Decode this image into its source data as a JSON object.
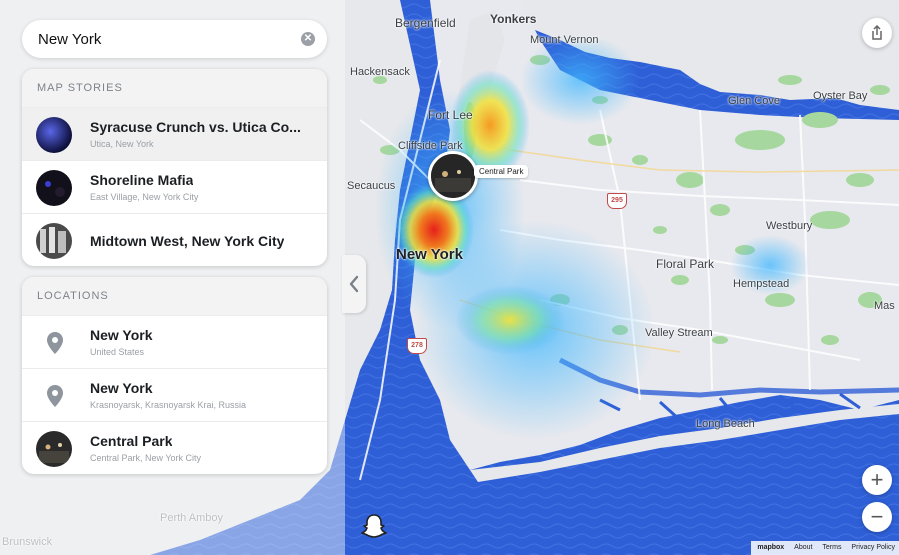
{
  "search": {
    "value": "New York",
    "clear_icon": "clear-icon"
  },
  "map_stories": {
    "header": "MAP STORIES",
    "items": [
      {
        "title": "Syracuse Crunch vs. Utica Co...",
        "subtitle": "Utica, New York",
        "thumb_color": "#1a1f6e"
      },
      {
        "title": "Shoreline Mafia",
        "subtitle": "East Village, New York City",
        "thumb_color": "#15131c"
      },
      {
        "title": "Midtown West, New York City",
        "subtitle": "",
        "thumb_color": "#3b3b3b"
      }
    ]
  },
  "locations": {
    "header": "LOCATIONS",
    "items": [
      {
        "title": "New York",
        "subtitle": "United States",
        "icon": "location-pin-icon"
      },
      {
        "title": "New York",
        "subtitle": "Krasnoyarsk, Krasnoyarsk Krai, Russia",
        "icon": "location-pin-icon"
      },
      {
        "title": "Central Park",
        "subtitle": "Central Park, New York City",
        "icon": "place-photo"
      }
    ]
  },
  "map": {
    "bubble_label": "Central Park",
    "labels": {
      "bergenfield": "Bergenfield",
      "yonkers": "Yonkers",
      "mount_vernon": "Mount Vernon",
      "hackensack": "Hackensack",
      "fort_lee": "Fort Lee",
      "cliffside_park": "Cliffside Park",
      "secaucus": "Secaucus",
      "new_york": "New York",
      "glen_cove": "Glen Cove",
      "oyster_bay": "Oyster Bay",
      "westbury": "Westbury",
      "floral_park": "Floral Park",
      "hempstead": "Hempstead",
      "masc": "Mas",
      "valley_stream": "Valley Stream",
      "long_beach": "Long Beach",
      "perth_amboy": "Perth Amboy",
      "brunswick": "Brunswick"
    },
    "shields": {
      "i295": "295",
      "i278": "278"
    },
    "colors": {
      "water": "#2e5fd6",
      "land": "#e9ebee",
      "park": "#9fd39a"
    }
  },
  "controls": {
    "zoom_in": "+",
    "zoom_out": "−",
    "share_icon": "share-icon",
    "collapse_icon": "chevron-left-icon",
    "ghost_icon": "snapchat-ghost-icon"
  },
  "attribution": {
    "mapbox": "mapbox",
    "about": "About",
    "terms": "Terms",
    "privacy": "Privacy Policy"
  }
}
